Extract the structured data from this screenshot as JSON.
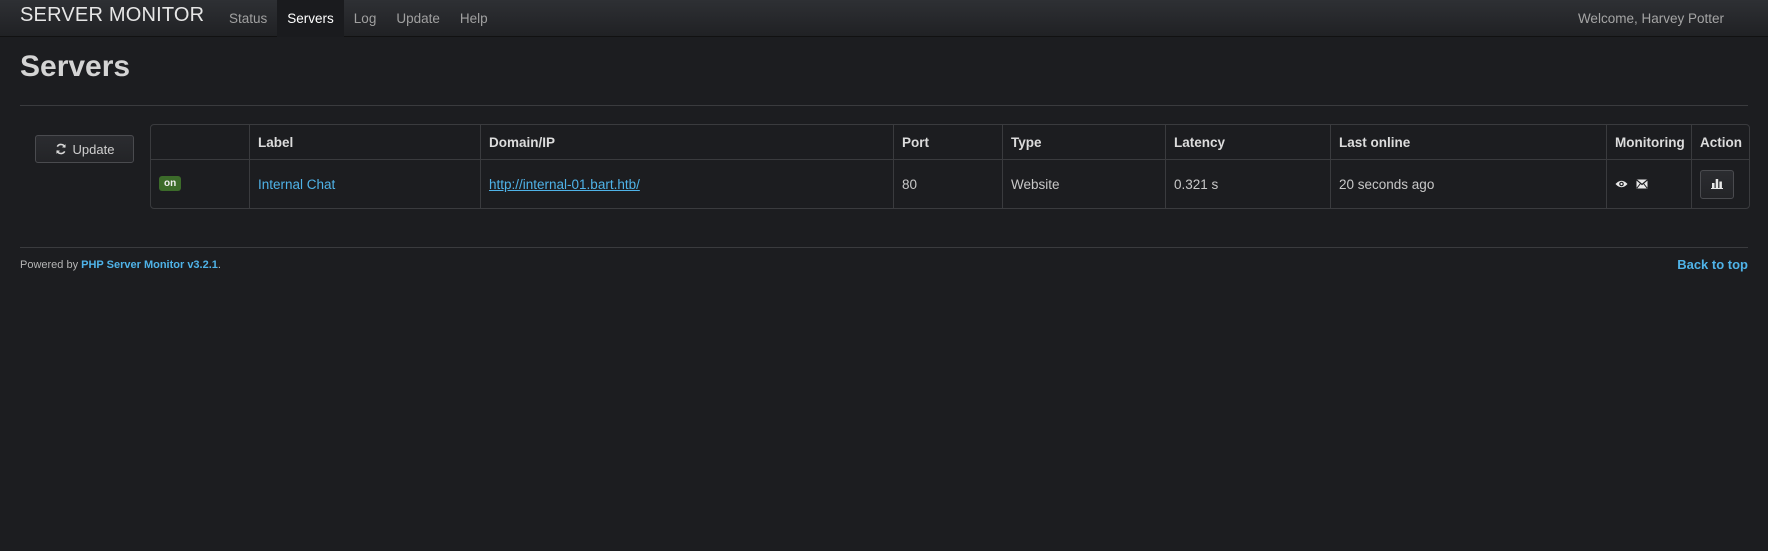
{
  "app": {
    "brand": "SERVER MONITOR",
    "welcome": "Welcome, Harvey Potter"
  },
  "nav": {
    "items": [
      {
        "label": "Status"
      },
      {
        "label": "Servers"
      },
      {
        "label": "Log"
      },
      {
        "label": "Update"
      },
      {
        "label": "Help"
      }
    ],
    "active": "Servers"
  },
  "page": {
    "title": "Servers",
    "update_button": "Update"
  },
  "table": {
    "headers": [
      "",
      "Label",
      "Domain/IP",
      "Port",
      "Type",
      "Latency",
      "Last online",
      "Monitoring",
      "Action"
    ],
    "rows": [
      {
        "status": "on",
        "label": "Internal Chat",
        "domain": "http://internal-01.bart.htb/",
        "port": "80",
        "type": "Website",
        "latency": "0.321 s",
        "last_online": "20 seconds ago",
        "monitoring_icons": [
          "eye-icon",
          "envelope-icon"
        ],
        "action_icon": "bar-chart-icon"
      }
    ]
  },
  "footer": {
    "powered_by": "Powered by",
    "product": "PHP Server Monitor v3.2.1",
    "period": ".",
    "back_to_top": "Back to top"
  },
  "colors": {
    "background": "#1c1d20",
    "link": "#4fb3e8",
    "badge_on": "#3c6b2a"
  }
}
